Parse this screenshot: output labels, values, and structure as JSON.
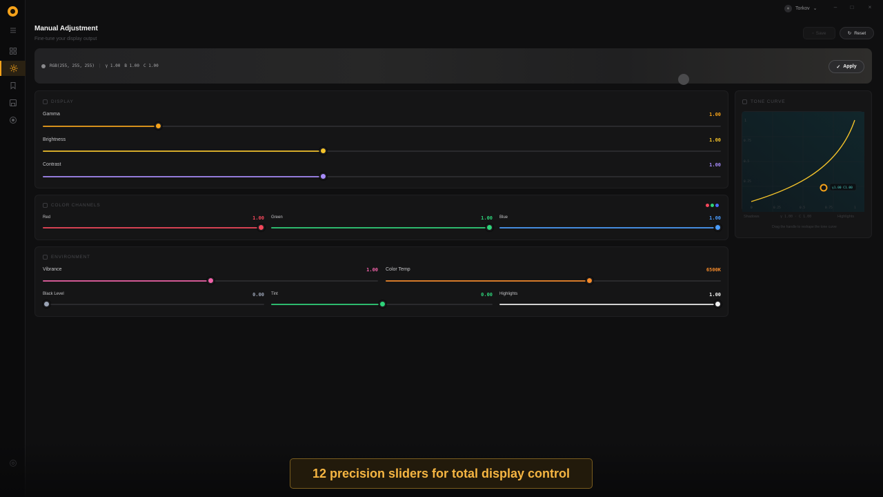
{
  "titlebar": {
    "user": "Torkov",
    "min": "–",
    "max": "□",
    "close": "×"
  },
  "header": {
    "title": "Manual Adjustment",
    "subtitle": "Fine-tune your display output",
    "save_label": "Save",
    "reset_label": "Reset"
  },
  "preview": {
    "rgb": "RGB(255, 255, 255)",
    "sep": "|",
    "gamma": "γ 1.00",
    "brightness": "B 1.00",
    "contrast": "C 1.00",
    "apply_label": "Apply"
  },
  "display": {
    "title": "Display",
    "sliders": [
      {
        "label": "Gamma",
        "value": "1.00",
        "color": "#f5a21a",
        "fraction": 0.17
      },
      {
        "label": "Brightness",
        "value": "1.00",
        "color": "#f3c22a",
        "fraction": 0.413
      },
      {
        "label": "Contrast",
        "value": "1.00",
        "color": "#a78bfa",
        "fraction": 0.413
      }
    ]
  },
  "channels": {
    "title": "Color Channels",
    "sliders": [
      {
        "label": "Red",
        "value": "1.00",
        "color": "#f4475b",
        "fraction": 1.0
      },
      {
        "label": "Green",
        "value": "1.00",
        "color": "#2ed47a",
        "fraction": 1.0
      },
      {
        "label": "Blue",
        "value": "1.00",
        "color": "#4a9dff",
        "fraction": 1.0
      }
    ]
  },
  "environment": {
    "title": "Environment",
    "vibrance": {
      "label": "Vibrance",
      "value": "1.00",
      "color": "#f062a8",
      "fraction": 0.5
    },
    "color_temp": {
      "label": "Color Temp",
      "value": "6500K",
      "color": "#f58a2a",
      "fraction": 0.608
    },
    "black_level": {
      "label": "Black Level",
      "value": "0.00",
      "color": "#9aa3b5",
      "fraction": 0.0
    },
    "tint": {
      "label": "Tint",
      "value": "0.00",
      "color": "#2ed47a",
      "fraction": 0.5
    },
    "highlights": {
      "label": "Highlights",
      "value": "1.00",
      "color": "#f0f0f0",
      "fraction": 1.0
    }
  },
  "tone_curve": {
    "title": "Tone Curve",
    "y_ticks": [
      "1",
      "0.75",
      "0.5",
      "0.25"
    ],
    "x_ticks": [
      "0",
      "0.25",
      "0.5",
      "0.75",
      "1"
    ],
    "point_label": "γ1.00 C1.00",
    "shadows": "Shadows",
    "highlights": "Highlights",
    "readout": "γ 1.00 · C 1.00",
    "hint": "Drag the handle to reshape the tone curve",
    "curve_color": "#f3c22a"
  },
  "caption": "12 precision sliders for total display control"
}
